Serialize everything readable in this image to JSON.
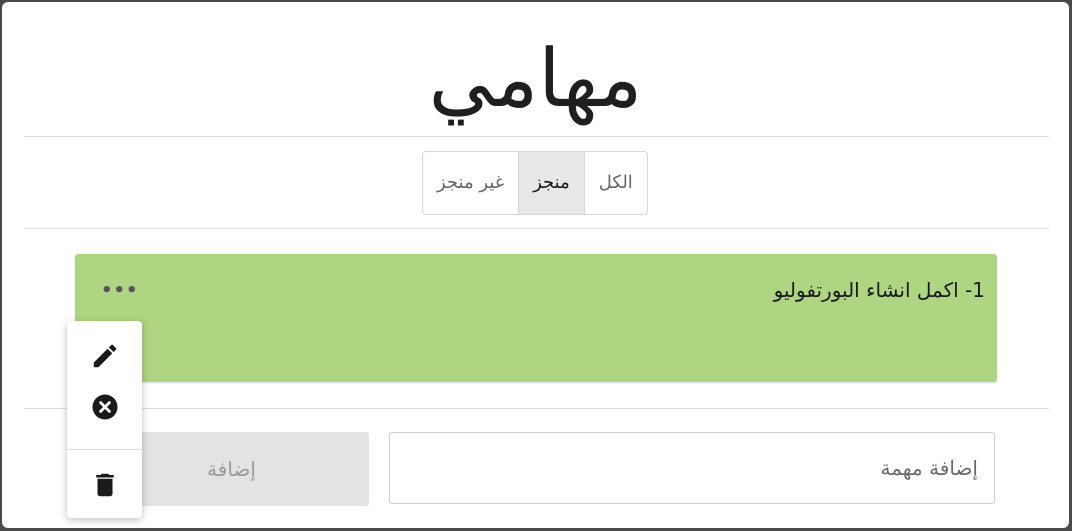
{
  "title": "مهامي",
  "filters": [
    {
      "label": "الكل",
      "active": false
    },
    {
      "label": "منجز",
      "active": true
    },
    {
      "label": "غير منجز",
      "active": false
    }
  ],
  "tasks": [
    {
      "text": "1- اكمل انشاء البورتفوليو",
      "menu_label": "•••"
    }
  ],
  "task_menu": {
    "items": [
      "pencil-icon",
      "close-circle-icon",
      "trash-icon"
    ]
  },
  "new_task": {
    "placeholder": "إضافة مهمة",
    "value": "",
    "add_label": "إضافة"
  },
  "colors": {
    "task_bg": "#aed581",
    "active_filter_bg": "#e8e8e8",
    "button_disabled_bg": "#e3e3e3"
  }
}
